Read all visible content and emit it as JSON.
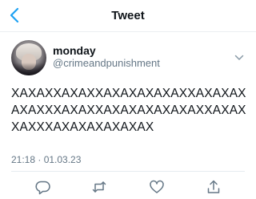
{
  "header": {
    "title": "Tweet"
  },
  "author": {
    "display_name": "monday",
    "handle": "@crimeandpunishment"
  },
  "tweet": {
    "text": "XAXAXXAXAXXAXAXAXAXAXXAXAXAXAXAXXXAXAXXAXAXAXAXAXAXXAXAXXAXXXAXAXAXAXAXAX",
    "timestamp": "21:18 · 01.03.23"
  },
  "icons": {
    "back": "chevron-left-icon",
    "menu": "chevron-down-icon",
    "reply": "reply-icon",
    "retweet": "retweet-icon",
    "like": "heart-icon",
    "share": "share-icon"
  },
  "colors": {
    "accent": "#1da1f2",
    "text": "#0f1419",
    "secondary": "#657786",
    "icon": "#657786"
  }
}
